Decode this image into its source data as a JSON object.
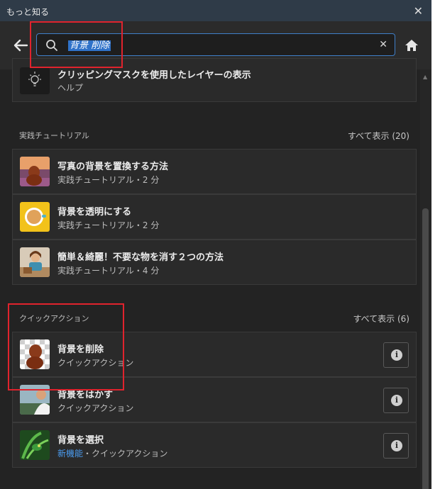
{
  "window": {
    "title": "もっと知る",
    "close_glyph": "✕"
  },
  "search": {
    "value": "背景 削除",
    "clear_glyph": "✕"
  },
  "icons": {
    "back": "arrow-left-icon",
    "search": "search-icon",
    "home": "home-icon",
    "help": "lightbulb-icon",
    "info": "info-icon"
  },
  "help_item": {
    "title": "クリッピングマスクを使用したレイヤーの表示",
    "subtitle": "ヘルプ"
  },
  "tutorials": {
    "heading": "実践チュートリアル",
    "show_all": "すべて表示 (20)",
    "items": [
      {
        "title": "写真の背景を置換する方法",
        "subtitle": "実践チュートリアル・2 分"
      },
      {
        "title": "背景を透明にする",
        "subtitle": "実践チュートリアル・2 分"
      },
      {
        "title": "簡単＆綺麗！不要な物を消す２つの方法",
        "subtitle": "実践チュートリアル・4 分"
      }
    ]
  },
  "quick_actions": {
    "heading": "クイックアクション",
    "show_all": "すべて表示 (6)",
    "items": [
      {
        "title": "背景を削除",
        "subtitle": "クイックアクション"
      },
      {
        "title": "背景をはかす",
        "subtitle": "クイックアクション"
      },
      {
        "title": "背景を選択",
        "new_label": "新機能",
        "subtitle": "・クイックアクション"
      }
    ]
  },
  "colors": {
    "accent": "#3f7fc9",
    "highlight": "#e0232d",
    "new": "#4b9cf0"
  }
}
